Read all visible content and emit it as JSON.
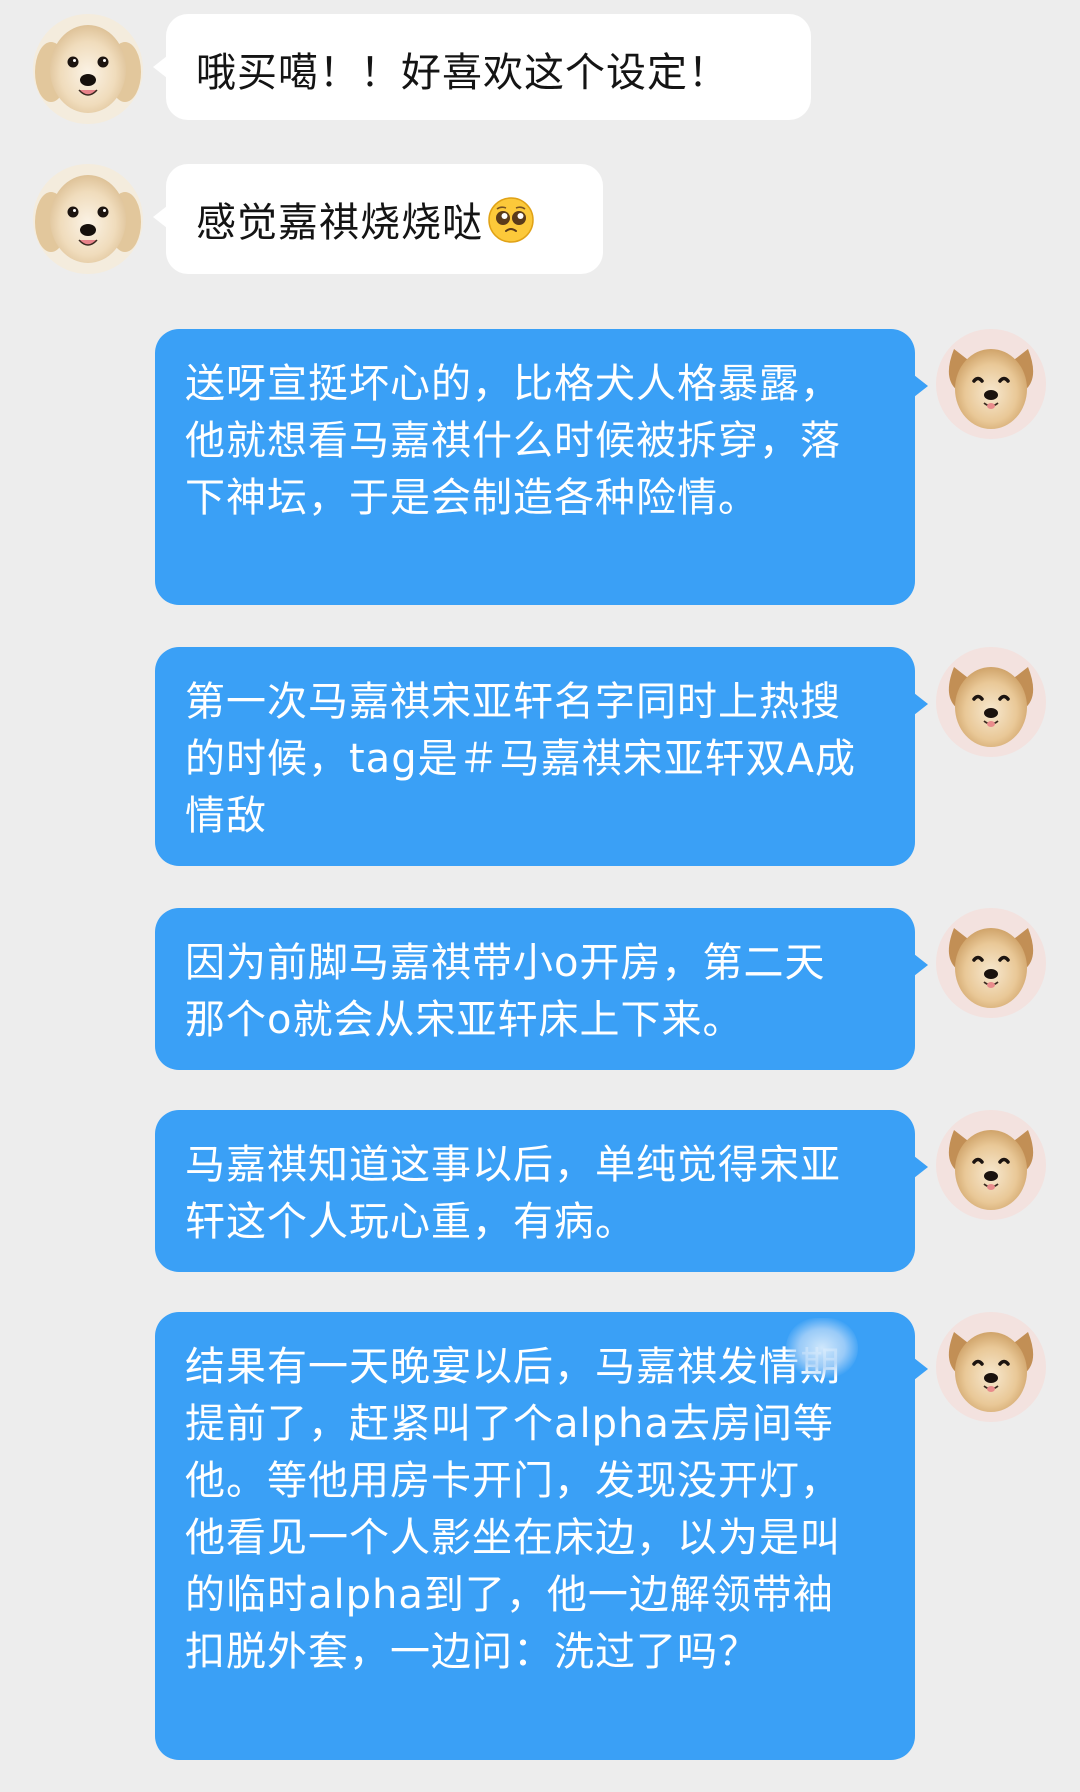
{
  "messages": [
    {
      "side": "left",
      "avatar": "golden-retriever-avatar",
      "text": "哦买噶！！好喜欢这个设定！"
    },
    {
      "side": "left",
      "avatar": "golden-retriever-avatar",
      "text": "感觉嘉祺烧烧哒",
      "emoji": "pleading-face-emoji"
    },
    {
      "side": "right",
      "avatar": "puppy-avatar",
      "text": "送呀宣挺坏心的，比格犬人格暴露，他就想看马嘉祺什么时候被拆穿，落下神坛，于是会制造各种险情。"
    },
    {
      "side": "right",
      "avatar": "puppy-avatar",
      "text": "第一次马嘉祺宋亚轩名字同时上热搜的时候，tag是＃马嘉祺宋亚轩双A成情敌"
    },
    {
      "side": "right",
      "avatar": "puppy-avatar",
      "text": "因为前脚马嘉祺带小o开房，第二天那个o就会从宋亚轩床上下来。"
    },
    {
      "side": "right",
      "avatar": "puppy-avatar",
      "text": "马嘉祺知道这事以后，单纯觉得宋亚轩这个人玩心重，有病。"
    },
    {
      "side": "right",
      "avatar": "puppy-avatar",
      "text": "结果有一天晚宴以后，马嘉祺发情期提前了，赶紧叫了个alpha去房间等他。等他用房卡开门，发现没开灯，他看见一个人影坐在床边，以为是叫的临时alpha到了，他一边解领带袖扣脱外套，一边问：洗过了吗？"
    }
  ],
  "colors": {
    "background": "#ededed",
    "incoming_bubble": "#ffffff",
    "outgoing_bubble": "#3aa0f6",
    "outgoing_text": "#ffffff"
  }
}
